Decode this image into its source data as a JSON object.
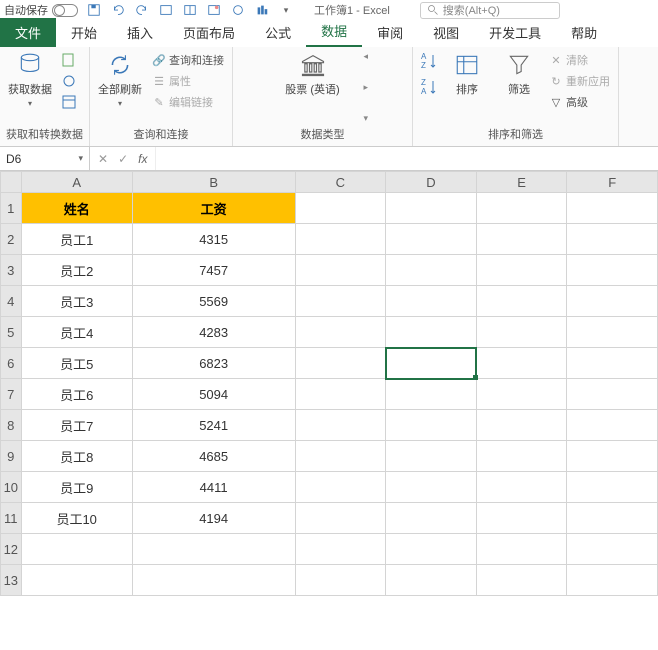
{
  "titlebar": {
    "autosave": "自动保存",
    "title": "工作簿1 - Excel",
    "search_placeholder": "搜索(Alt+Q)"
  },
  "tabs": {
    "file": "文件",
    "home": "开始",
    "insert": "插入",
    "layout": "页面布局",
    "formulas": "公式",
    "data": "数据",
    "review": "审阅",
    "view": "视图",
    "dev": "开发工具",
    "help": "帮助"
  },
  "ribbon": {
    "get_data": "获取数据",
    "group1": "获取和转换数据",
    "refresh": "全部刷新",
    "queries": "查询和连接",
    "props": "属性",
    "editlinks": "编辑链接",
    "group2": "查询和连接",
    "stocks": "股票 (英语)",
    "group3": "数据类型",
    "sort": "排序",
    "filter": "筛选",
    "clear": "清除",
    "reapply": "重新应用",
    "advanced": "高级",
    "group4": "排序和筛选"
  },
  "namebox": "D6",
  "chart_data": {
    "type": "table",
    "headers": [
      "姓名",
      "工资"
    ],
    "rows": [
      [
        "员工1",
        4315
      ],
      [
        "员工2",
        7457
      ],
      [
        "员工3",
        5569
      ],
      [
        "员工4",
        4283
      ],
      [
        "员工5",
        6823
      ],
      [
        "员工6",
        5094
      ],
      [
        "员工7",
        5241
      ],
      [
        "员工8",
        4685
      ],
      [
        "员工9",
        4411
      ],
      [
        "员工10",
        4194
      ]
    ]
  },
  "columns": [
    "A",
    "B",
    "C",
    "D",
    "E",
    "F"
  ],
  "visible_rows": 13,
  "selected_cell": {
    "row": 6,
    "col": "D"
  }
}
